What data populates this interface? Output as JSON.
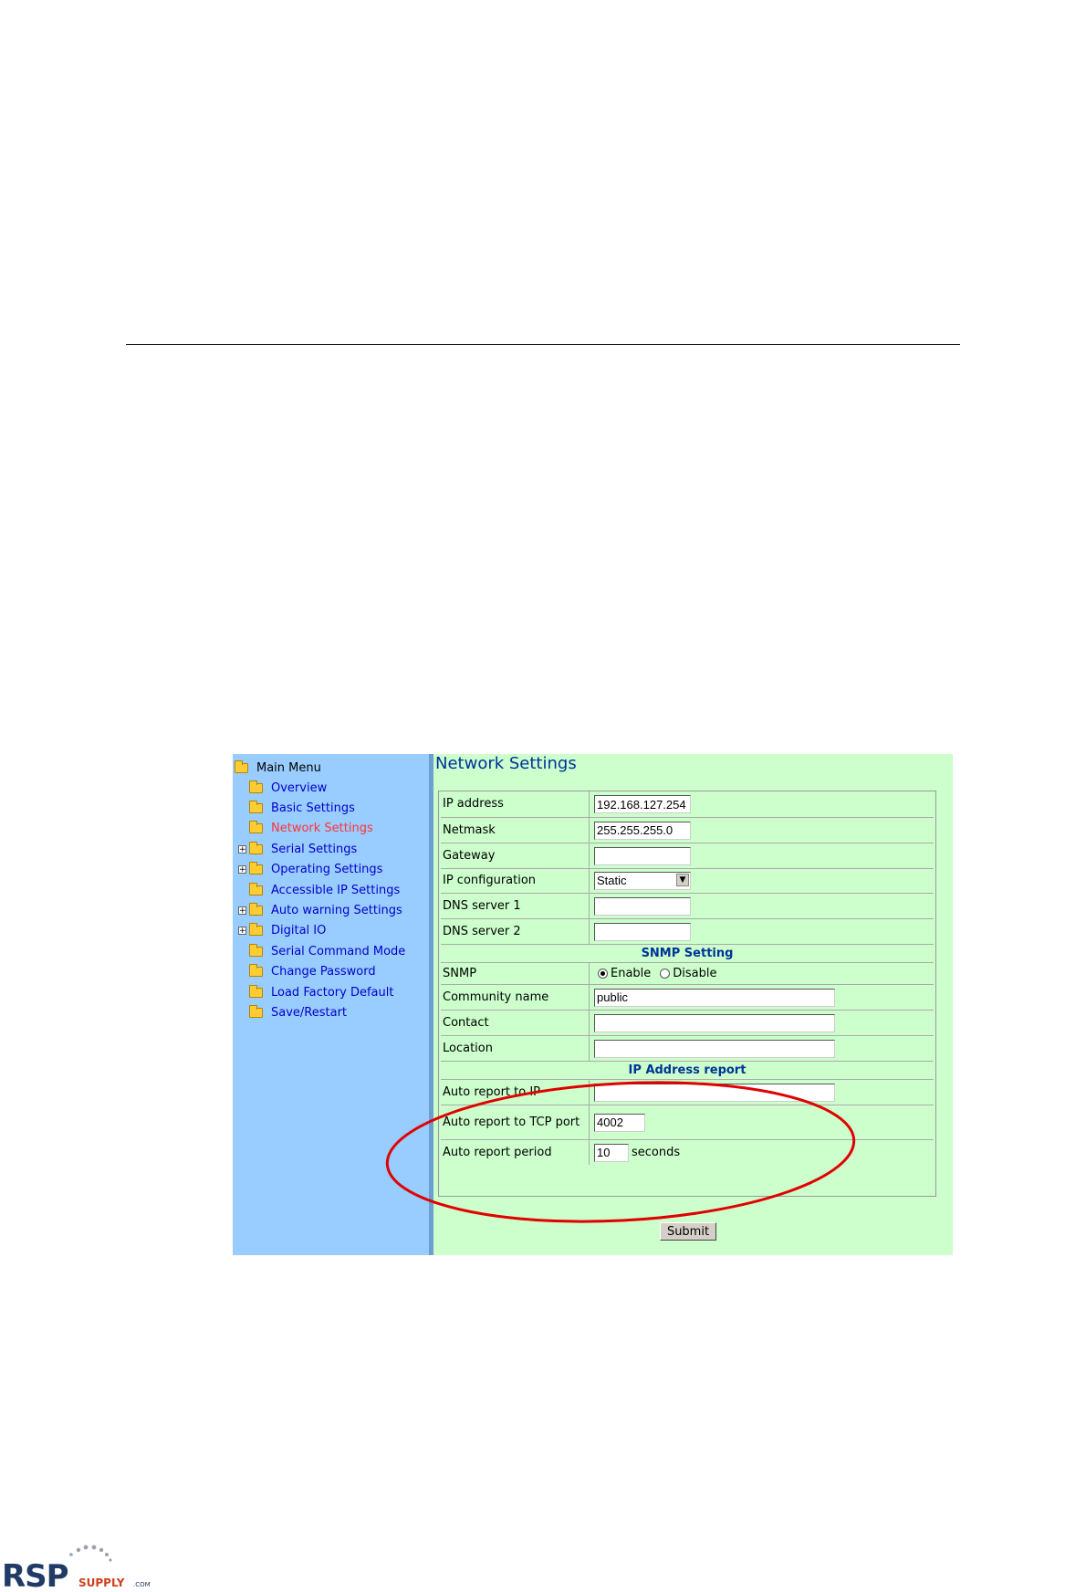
{
  "nav": {
    "root": "Main Menu",
    "items": [
      {
        "label": "Overview",
        "expandable": false,
        "active": false
      },
      {
        "label": "Basic Settings",
        "expandable": false,
        "active": false
      },
      {
        "label": "Network Settings",
        "expandable": false,
        "active": true
      },
      {
        "label": "Serial Settings",
        "expandable": true,
        "active": false
      },
      {
        "label": "Operating Settings",
        "expandable": true,
        "active": false
      },
      {
        "label": "Accessible IP Settings",
        "expandable": false,
        "active": false
      },
      {
        "label": "Auto warning Settings",
        "expandable": true,
        "active": false
      },
      {
        "label": "Digital IO",
        "expandable": true,
        "active": false
      },
      {
        "label": "Serial Command Mode",
        "expandable": false,
        "active": false
      },
      {
        "label": "Change Password",
        "expandable": false,
        "active": false
      },
      {
        "label": "Load Factory Default",
        "expandable": false,
        "active": false
      },
      {
        "label": "Save/Restart",
        "expandable": false,
        "active": false
      }
    ]
  },
  "page": {
    "title": "Network Settings",
    "ip_address": {
      "label": "IP address",
      "value": "192.168.127.254"
    },
    "netmask": {
      "label": "Netmask",
      "value": "255.255.255.0"
    },
    "gateway": {
      "label": "Gateway",
      "value": ""
    },
    "ip_config": {
      "label": "IP configuration",
      "value": "Static"
    },
    "dns1": {
      "label": "DNS server 1",
      "value": ""
    },
    "dns2": {
      "label": "DNS server 2",
      "value": ""
    },
    "snmp_section": "SNMP Setting",
    "snmp": {
      "label": "SNMP",
      "enable": "Enable",
      "disable": "Disable",
      "selected": "Enable"
    },
    "community": {
      "label": "Community name",
      "value": "public"
    },
    "contact": {
      "label": "Contact",
      "value": ""
    },
    "location": {
      "label": "Location",
      "value": ""
    },
    "ip_report_section": "IP Address report",
    "auto_ip": {
      "label": "Auto report to IP",
      "value": ""
    },
    "auto_tcp": {
      "label": "Auto report to TCP port",
      "value": "4002"
    },
    "auto_period": {
      "label": "Auto report period",
      "value": "10",
      "unit": "seconds"
    },
    "submit": "Submit"
  },
  "colors": {
    "nav_bg": "#99ccff",
    "content_bg": "#ccffcc",
    "link": "#0000cc",
    "active_link": "#ff3333",
    "heading": "#003399",
    "annotation": "#e00000"
  },
  "logo": {
    "main": "RSP",
    "sub": "SUPPLY",
    "suffix": ".COM"
  }
}
